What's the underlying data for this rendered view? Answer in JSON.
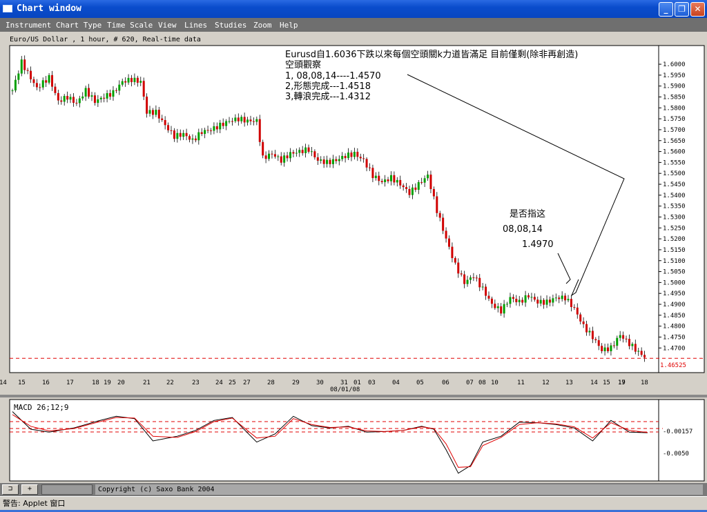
{
  "window": {
    "title": "Chart window",
    "controls": [
      "minimize-icon",
      "maximize-icon",
      "close-icon"
    ]
  },
  "menu": [
    "Instrument",
    "Chart Type",
    "Time Scale",
    "View",
    "Lines",
    "Studies",
    "Zoom",
    "Help"
  ],
  "chart": {
    "subtitle": "Euro/US Dollar , 1 hour, # 620, Real-time data",
    "annotation_lines": [
      "Eurusd自1.6036下跌以來每個空頭關k力道皆滿足 目前僅剩(除非再創造)",
      "空頭觀察",
      "1, 08,08,14----1.4570",
      "2,形態完成---1.4518",
      "3,轉浪完成---1.4312"
    ],
    "question_lines": [
      "是否指这",
      "08,08,14",
      "1.4970"
    ],
    "price_label": "1.46525",
    "date_label": "08/01/08",
    "macd_label": "MACD 26;12;9",
    "macd_current": "-0.00157",
    "macd_tick": "-0.0050"
  },
  "chart_data": [
    {
      "type": "line",
      "subtype": "candlestick",
      "title": "Euro/US Dollar , 1 hour, # 620, Real-time data",
      "x_tick_labels": [
        "14",
        "15",
        "16",
        "17",
        "18",
        "19",
        "20",
        "21",
        "22",
        "23",
        "24",
        "25",
        "27",
        "28",
        "29",
        "30",
        "31",
        "01",
        "03",
        "04",
        "05",
        "06",
        "07",
        "08",
        "10",
        "11",
        "12",
        "13",
        "14",
        "15",
        "17",
        "18",
        "19"
      ],
      "x_extra_label": "08/01/08",
      "y_tick_labels": [
        "1.6000",
        "1.5950",
        "1.5900",
        "1.5850",
        "1.5800",
        "1.5750",
        "1.5700",
        "1.5650",
        "1.5600",
        "1.5550",
        "1.5500",
        "1.5450",
        "1.5400",
        "1.5350",
        "1.5300",
        "1.5250",
        "1.5200",
        "1.5150",
        "1.5100",
        "1.5050",
        "1.5000",
        "1.4950",
        "1.4900",
        "1.4850",
        "1.4800",
        "1.4750",
        "1.4700",
        "1.46525"
      ],
      "ylim": [
        1.4625,
        1.6035
      ],
      "series": [
        {
          "values": [
            [
              0,
              1.588
            ],
            [
              3,
              1.601
            ],
            [
              5,
              1.596
            ],
            [
              8,
              1.589
            ],
            [
              12,
              1.594
            ],
            [
              15,
              1.583
            ],
            [
              18,
              1.585
            ],
            [
              21,
              1.582
            ],
            [
              24,
              1.588
            ],
            [
              27,
              1.583
            ],
            [
              30,
              1.585
            ],
            [
              33,
              1.587
            ],
            [
              36,
              1.592
            ],
            [
              39,
              1.593
            ],
            [
              42,
              1.592
            ],
            [
              44,
              1.578
            ],
            [
              47,
              1.578
            ],
            [
              50,
              1.572
            ],
            [
              53,
              1.567
            ],
            [
              56,
              1.568
            ],
            [
              59,
              1.565
            ],
            [
              62,
              1.569
            ],
            [
              65,
              1.57
            ],
            [
              68,
              1.572
            ],
            [
              71,
              1.574
            ],
            [
              74,
              1.575
            ],
            [
              77,
              1.574
            ],
            [
              80,
              1.574
            ],
            [
              82,
              1.557
            ],
            [
              85,
              1.559
            ],
            [
              88,
              1.556
            ],
            [
              91,
              1.559
            ],
            [
              94,
              1.56
            ],
            [
              97,
              1.561
            ],
            [
              100,
              1.556
            ],
            [
              103,
              1.555
            ],
            [
              106,
              1.556
            ],
            [
              109,
              1.558
            ],
            [
              112,
              1.559
            ],
            [
              115,
              1.556
            ],
            [
              118,
              1.549
            ],
            [
              121,
              1.546
            ],
            [
              124,
              1.548
            ],
            [
              127,
              1.545
            ],
            [
              130,
              1.541
            ],
            [
              133,
              1.545
            ],
            [
              136,
              1.549
            ],
            [
              139,
              1.533
            ],
            [
              142,
              1.52
            ],
            [
              145,
              1.508
            ],
            [
              148,
              1.5
            ],
            [
              151,
              1.503
            ],
            [
              154,
              1.497
            ],
            [
              157,
              1.49
            ],
            [
              160,
              1.487
            ],
            [
              163,
              1.493
            ],
            [
              166,
              1.491
            ],
            [
              169,
              1.494
            ],
            [
              172,
              1.491
            ],
            [
              175,
              1.491
            ],
            [
              178,
              1.493
            ],
            [
              181,
              1.493
            ],
            [
              184,
              1.488
            ],
            [
              187,
              1.48
            ],
            [
              190,
              1.475
            ],
            [
              193,
              1.469
            ],
            [
              196,
              1.47
            ],
            [
              199,
              1.476
            ],
            [
              202,
              1.472
            ],
            [
              205,
              1.468
            ],
            [
              208,
              1.465
            ]
          ]
        }
      ]
    },
    {
      "type": "line",
      "title": "MACD 26;12;9",
      "y_tick_labels": [
        "-0.00157",
        "-0.0050"
      ],
      "series": [
        {
          "values": [
            [
              0,
              0.002
            ],
            [
              6,
              -0.001
            ],
            [
              12,
              -0.0015
            ],
            [
              20,
              -0.0008
            ],
            [
              28,
              0.0004
            ],
            [
              34,
              0.0012
            ],
            [
              40,
              0.0008
            ],
            [
              46,
              -0.003
            ],
            [
              54,
              -0.0022
            ],
            [
              60,
              -0.0012
            ],
            [
              66,
              0.0005
            ],
            [
              72,
              0.001
            ],
            [
              80,
              -0.0032
            ],
            [
              86,
              -0.0018
            ],
            [
              92,
              0.0012
            ],
            [
              98,
              -0.0004
            ],
            [
              104,
              -0.0008
            ],
            [
              110,
              -0.0005
            ],
            [
              116,
              -0.0015
            ],
            [
              122,
              -0.0014
            ],
            [
              128,
              -0.0012
            ],
            [
              134,
              -0.0005
            ],
            [
              138,
              -0.001
            ],
            [
              142,
              -0.0045
            ],
            [
              146,
              -0.0085
            ],
            [
              150,
              -0.0072
            ],
            [
              154,
              -0.0032
            ],
            [
              160,
              -0.0022
            ],
            [
              166,
              0.0002
            ],
            [
              172,
              0.0001
            ],
            [
              178,
              -0.0002
            ],
            [
              184,
              -0.0008
            ],
            [
              190,
              -0.003
            ],
            [
              196,
              0.0005
            ],
            [
              202,
              -0.0015
            ],
            [
              208,
              -0.0016
            ]
          ]
        },
        {
          "values": [
            [
              0,
              0.0015
            ],
            [
              6,
              -0.0005
            ],
            [
              12,
              -0.0013
            ],
            [
              20,
              -0.0009
            ],
            [
              28,
              0.0002
            ],
            [
              34,
              0.001
            ],
            [
              40,
              0.0009
            ],
            [
              46,
              -0.0022
            ],
            [
              54,
              -0.0024
            ],
            [
              60,
              -0.0014
            ],
            [
              66,
              0.0003
            ],
            [
              72,
              0.0009
            ],
            [
              80,
              -0.0025
            ],
            [
              86,
              -0.0022
            ],
            [
              92,
              0.0008
            ],
            [
              98,
              -0.0002
            ],
            [
              104,
              -0.0007
            ],
            [
              110,
              -0.0006
            ],
            [
              116,
              -0.0013
            ],
            [
              122,
              -0.0014
            ],
            [
              128,
              -0.0012
            ],
            [
              134,
              -0.0006
            ],
            [
              138,
              -0.0009
            ],
            [
              142,
              -0.0035
            ],
            [
              146,
              -0.0075
            ],
            [
              150,
              -0.0074
            ],
            [
              154,
              -0.0038
            ],
            [
              160,
              -0.0024
            ],
            [
              166,
              -0.0002
            ],
            [
              172,
              0.0001
            ],
            [
              178,
              -0.0001
            ],
            [
              184,
              -0.0006
            ],
            [
              190,
              -0.0025
            ],
            [
              196,
              0.0001
            ],
            [
              202,
              -0.0012
            ],
            [
              208,
              -0.00157
            ]
          ]
        }
      ]
    }
  ],
  "statusbar": {
    "copyright": "Copyright (c) Saxo Bank 2004"
  },
  "applet_warning": "警告: Applet 窗口",
  "colors": {
    "title_blue": "#0a4ccc",
    "candle_up": "#00a000",
    "candle_down": "#d00000",
    "ref_line": "#e00000",
    "macd_line": "#000000",
    "signal_line": "#e00000"
  }
}
